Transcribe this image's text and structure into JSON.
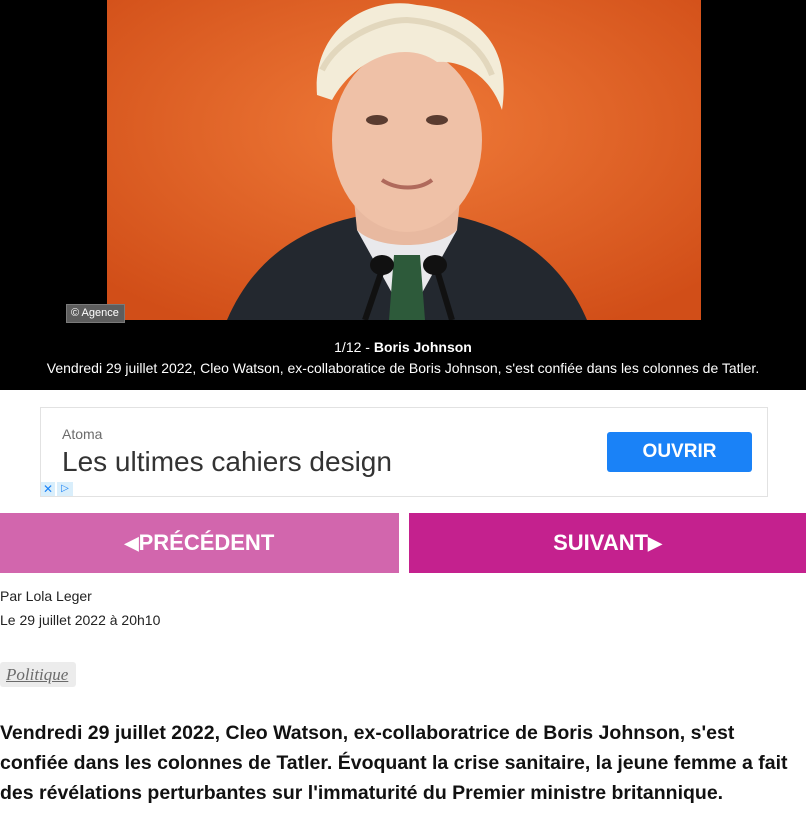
{
  "gallery": {
    "credit": "© Agence",
    "counter": "1/12 - ",
    "title": "Boris Johnson",
    "caption": "Vendredi 29 juillet 2022, Cleo Watson, ex-collaboratice de Boris Johnson, s'est confiée dans les colonnes de Tatler."
  },
  "ad": {
    "brand": "Atoma",
    "title": "Les ultimes cahiers design",
    "button": "OUVRIR",
    "close_icon": "close-icon",
    "adchoices_icon": "adchoices-icon"
  },
  "nav": {
    "prev_label": "PRÉCÉDENT",
    "next_label": "SUIVANT",
    "prev_color": "#d266ad",
    "next_color": "#c4218e"
  },
  "article": {
    "author": "Par Lola Leger",
    "date": "Le 29 juillet 2022 à 20h10",
    "tag": "Politique",
    "lead": "Vendredi 29 juillet 2022, Cleo Watson, ex-collaboratrice de Boris Johnson, s'est confiée dans les colonnes de Tatler. Évoquant la crise sanitaire, la jeune femme a fait des révélations perturbantes sur l'immaturité du Premier ministre britannique."
  }
}
